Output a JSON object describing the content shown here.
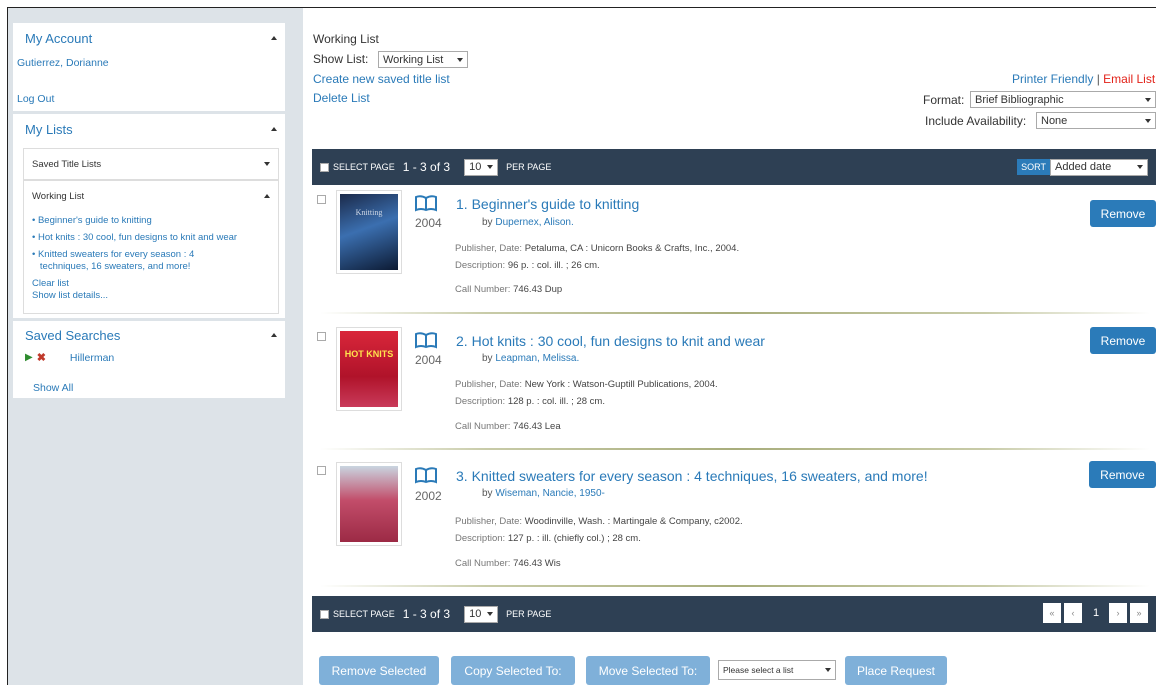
{
  "sidebar": {
    "account": {
      "title": "My Account",
      "user": "Gutierrez, Dorianne",
      "logout": "Log Out"
    },
    "lists": {
      "title": "My Lists",
      "saved_title_lists": "Saved Title Lists",
      "working_list": "Working List",
      "items": [
        "Beginner's guide to knitting",
        "Hot knits : 30 cool, fun designs to knit and wear",
        "Knitted sweaters for every season : 4",
        "techniques, 16 sweaters, and more!"
      ],
      "clear": "Clear list",
      "details": "Show list details..."
    },
    "searches": {
      "title": "Saved Searches",
      "item": "Hillerman",
      "show_all": "Show All"
    }
  },
  "header": {
    "title": "Working List",
    "show_list_label": "Show List:",
    "show_list_value": "Working List",
    "create": "Create new saved title list",
    "delete": "Delete List",
    "printer": "Printer Friendly",
    "sep": "|",
    "email": "Email List",
    "format_label": "Format:",
    "format_value": "Brief Bibliographic",
    "avail_label": "Include Availability:",
    "avail_value": "None"
  },
  "toolbar": {
    "select_page": "SELECT PAGE",
    "range": "1 - 3 of 3",
    "per_page_value": "10",
    "per_page": "PER PAGE",
    "sort_label": "SORT",
    "sort_value": "Added date"
  },
  "results": [
    {
      "num": "1.",
      "title": "Beginner's guide to knitting",
      "by": "by",
      "author": "Dupernex, Alison.",
      "year": "2004",
      "pub_label": "Publisher, Date:",
      "pub": "Petaluma, CA : Unicorn Books & Crafts, Inc., 2004.",
      "desc_label": "Description:",
      "desc": "96 p. : col. ill. ; 26 cm.",
      "call_label": "Call Number:",
      "call": "746.43 Dup",
      "cover_text": "Knitting"
    },
    {
      "num": "2.",
      "title": "Hot knits : 30 cool, fun designs to knit and wear",
      "by": "by",
      "author": "Leapman, Melissa.",
      "year": "2004",
      "pub_label": "Publisher, Date:",
      "pub": "New York : Watson-Guptill Publications, 2004.",
      "desc_label": "Description:",
      "desc": "128 p. : col. ill. ; 28 cm.",
      "call_label": "Call Number:",
      "call": "746.43 Lea",
      "cover_text": "HOT KNITS"
    },
    {
      "num": "3.",
      "title": "Knitted sweaters for every season : 4 techniques, 16 sweaters, and more!",
      "by": "by",
      "author": "Wiseman, Nancie, 1950-",
      "year": "2002",
      "pub_label": "Publisher, Date:",
      "pub": "Woodinville, Wash. : Martingale & Company, c2002.",
      "desc_label": "Description:",
      "desc": "127 p. : ill. (chiefly col.) ; 28 cm.",
      "call_label": "Call Number:",
      "call": "746.43 Wis",
      "cover_text": ""
    }
  ],
  "remove_label": "Remove",
  "pager": {
    "first": "«",
    "prev": "‹",
    "current": "1",
    "next": "›",
    "last": "»"
  },
  "actions": {
    "remove_selected": "Remove Selected",
    "copy_to": "Copy Selected To:",
    "move_to": "Move Selected To:",
    "select_list": "Please select a list",
    "place_request": "Place Request"
  },
  "colors": {
    "link": "#2a7ab8",
    "bar": "#2e4054",
    "button": "#2b7bb9",
    "email": "#e2231a"
  }
}
